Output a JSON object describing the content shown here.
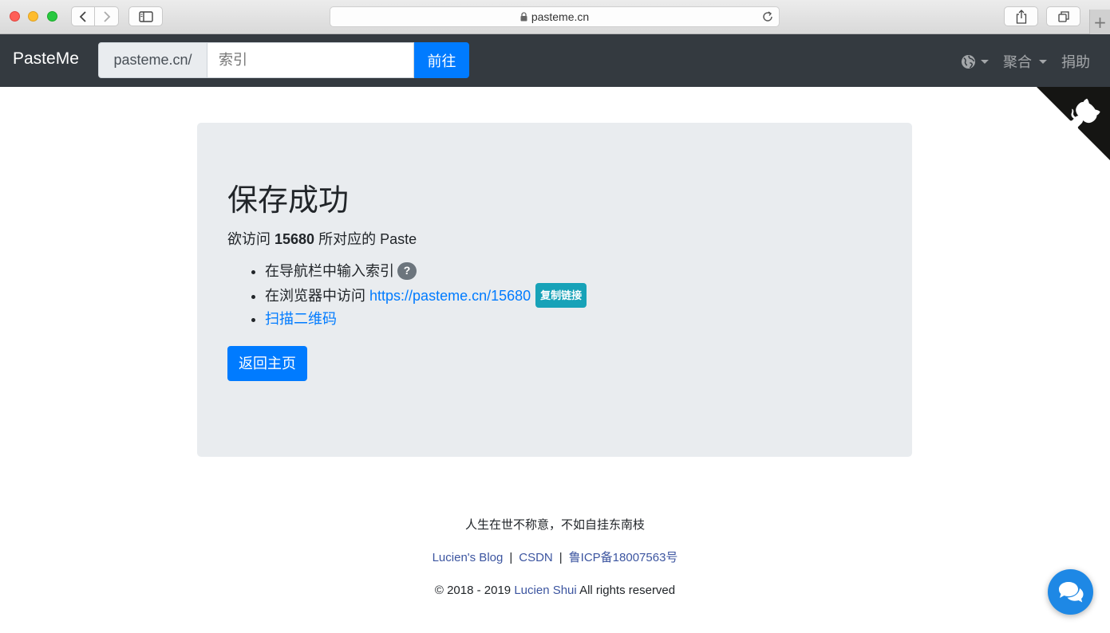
{
  "browser": {
    "url": "pasteme.cn",
    "new_tab": "+"
  },
  "navbar": {
    "brand": "PasteMe",
    "prefix": "pasteme.cn/",
    "search_placeholder": "索引",
    "go_label": "前往",
    "language_icon": "globe-icon",
    "aggregate_label": "聚合",
    "donate_label": "捐助"
  },
  "main": {
    "title": "保存成功",
    "lead_prefix": "欲访问 ",
    "paste_id": "15680",
    "lead_suffix": " 所对应的 Paste",
    "steps": [
      {
        "text": "在导航栏中输入索引",
        "badge": "?"
      },
      {
        "text": "在浏览器中访问 ",
        "link": "https://pasteme.cn/15680",
        "badge": "复制链接"
      },
      {
        "link": "扫描二维码"
      }
    ],
    "home_button": "返回主页"
  },
  "footer": {
    "quote": "人生在世不称意，不如自挂东南枝",
    "links": [
      "Lucien's Blog",
      "CSDN",
      "鲁ICP备18007563号"
    ],
    "separator": "|",
    "copyright_prefix": "© 2018 - 2019 ",
    "author": "Lucien Shui",
    "copyright_suffix": " All rights reserved"
  },
  "colors": {
    "navbar_bg": "#343a40",
    "primary": "#007bff",
    "info": "#17a2b8",
    "secondary": "#6c757d",
    "jumbotron_bg": "#e9ecef",
    "chat_bubble": "#1e88e5"
  }
}
